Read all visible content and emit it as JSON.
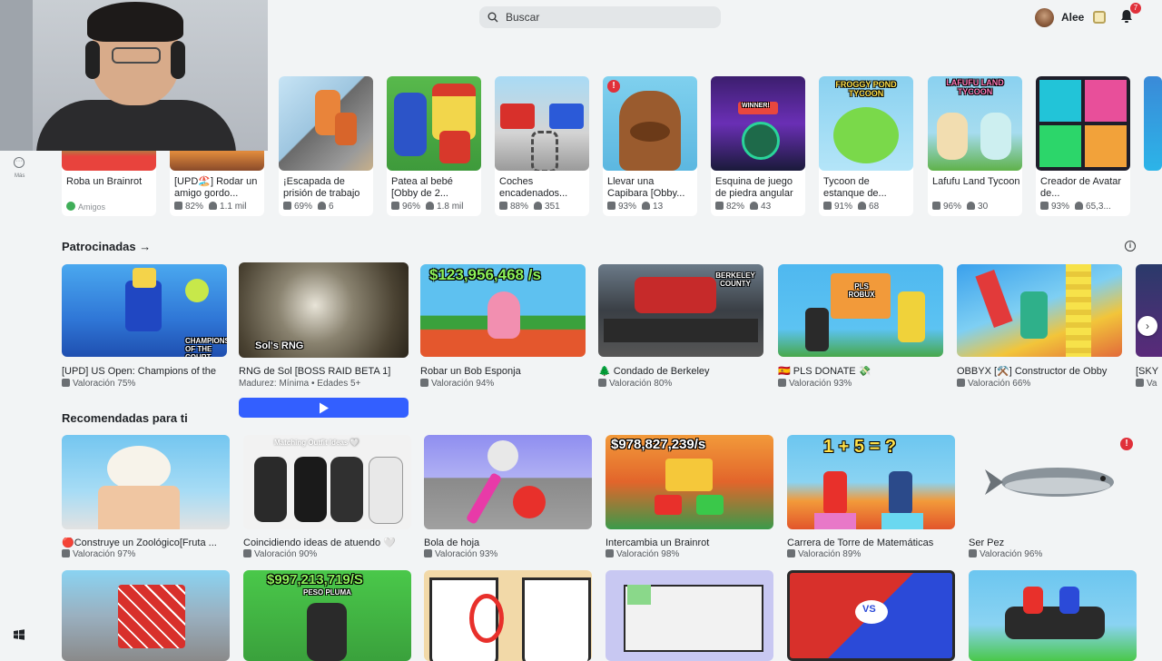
{
  "header": {
    "search_placeholder": "Buscar",
    "username": "Alee",
    "notification_count": "7"
  },
  "sidebar": {
    "more_label": "Más"
  },
  "continue_row": [
    {
      "title": "Roba un Brainrot",
      "friends": "Amigos"
    },
    {
      "title": "[UPD🏖️] Rodar un amigo gordo...",
      "rating": "82%",
      "players": "1.1 mil"
    },
    {
      "title": "¡Escapada de prisión de trabajo",
      "rating": "69%",
      "players": "6"
    },
    {
      "title": "Patea al bebé [Obby de 2...",
      "rating": "96%",
      "players": "1.8 mil"
    },
    {
      "title": "Coches encadenados...",
      "rating": "88%",
      "players": "351"
    },
    {
      "title": "Llevar una Capibara [Obby...",
      "rating": "93%",
      "players": "13"
    },
    {
      "title": "Esquina de juego de piedra angular",
      "rating": "82%",
      "players": "43"
    },
    {
      "title": "Tycoon de estanque de...",
      "rating": "91%",
      "players": "68"
    },
    {
      "title": "Lafufu Land Tycoon",
      "rating": "96%",
      "players": "30"
    },
    {
      "title": "Creador de Avatar de...",
      "rating": "93%",
      "players": "65,3..."
    }
  ],
  "continue_overlays": {
    "winner": "WINNER!",
    "tycoon1": "FROGGY POND TYCOON",
    "tycoon2": "LAFUFU LAND TYCOON"
  },
  "sponsored": {
    "heading": "Patrocinadas",
    "items": [
      {
        "title": "[UPD] US Open: Champions of the",
        "stats": "Valoración 75%"
      },
      {
        "title": "RNG de Sol [BOSS RAID BETA 1]",
        "stats": "Madurez: Mínima • Edades 5+"
      },
      {
        "title": "Robar un Bob Esponja",
        "stats": "Valoración 94%"
      },
      {
        "title": "🌲 Condado de Berkeley",
        "stats": "Valoración 80%"
      },
      {
        "title": "🇪🇸 PLS DONATE 💸",
        "stats": "Valoración 93%"
      },
      {
        "title": "OBBYX [⚒️] Constructor de Obby",
        "stats": "Valoración 66%"
      },
      {
        "title": "[SKY",
        "stats": "Va"
      }
    ],
    "overlays": {
      "court": "CHAMPIONS OF THE COURT",
      "sols": "Sol's RNG",
      "money": "$123,956,468 /s",
      "berkeley": "BERKELEY COUNTY",
      "plsdonate": "PLS ROBUX"
    }
  },
  "recommended": {
    "heading": "Recomendadas para ti",
    "items": [
      {
        "title": "🔴Construye un Zoológico[Fruta ...",
        "stats": "Valoración 97%"
      },
      {
        "title": "Coincidiendo ideas de atuendo 🤍",
        "stats": "Valoración 90%"
      },
      {
        "title": "Bola de hoja",
        "stats": "Valoración 93%"
      },
      {
        "title": "Intercambia un Brainrot",
        "stats": "Valoración 98%"
      },
      {
        "title": "Carrera de Torre de Matemáticas",
        "stats": "Valoración 89%"
      },
      {
        "title": "Ser Pez",
        "stats": "Valoración 96%"
      }
    ],
    "overlays": {
      "outfit": "Matching Outfit Ideas 🤍",
      "money2": "$978,827,239/s",
      "math": "1 + 5 = ?"
    }
  },
  "bottom_row_overlays": {
    "peso": "$997,213,719/S",
    "peso_sub": "PESO PLUMA",
    "vs": "VS"
  }
}
